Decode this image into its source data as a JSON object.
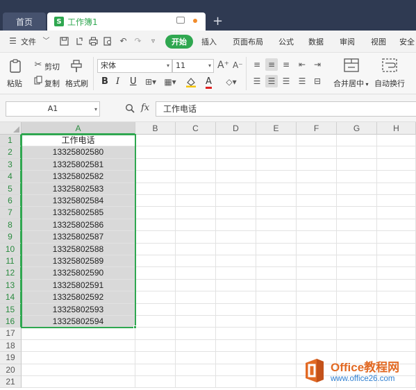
{
  "tabs": {
    "home": "首页",
    "workbook_badge": "S",
    "workbook": "工作簿1",
    "add": "+"
  },
  "menu": {
    "file": "文件",
    "start": "开始",
    "items": [
      "插入",
      "页面布局",
      "公式",
      "数据",
      "审阅",
      "视图",
      "安全"
    ]
  },
  "ribbon": {
    "paste": "粘贴",
    "cut": "剪切",
    "copy": "复制",
    "format_painter": "格式刷",
    "font_name": "宋体",
    "font_size": "11",
    "merge_center": "合并居中",
    "wrap_text": "自动换行",
    "bold": "B",
    "italic": "I",
    "underline": "U",
    "font_color_letter": "A"
  },
  "formula_bar": {
    "name_box": "A1",
    "fx": "fx",
    "content": "工作电话"
  },
  "sheet": {
    "columns": [
      "A",
      "B",
      "C",
      "D",
      "E",
      "F",
      "G",
      "H"
    ],
    "rows": [
      "1",
      "2",
      "3",
      "4",
      "5",
      "6",
      "7",
      "8",
      "9",
      "10",
      "11",
      "12",
      "13",
      "14",
      "15",
      "16",
      "17",
      "18",
      "19",
      "20",
      "21"
    ],
    "column_a": [
      "工作电话",
      "13325802580",
      "13325802581",
      "13325802582",
      "13325802583",
      "13325802584",
      "13325802585",
      "13325802586",
      "13325802587",
      "13325802588",
      "13325802589",
      "13325802590",
      "13325802591",
      "13325802592",
      "13325802593",
      "13325802594"
    ],
    "selection": "A1:A16"
  },
  "watermark": {
    "title": "Office教程网",
    "url": "www.office26.com"
  },
  "colors": {
    "accent": "#2fa750",
    "titlebar": "#2f3a52",
    "watermark_orange": "#e26a24",
    "watermark_blue": "#2f7fd1"
  }
}
